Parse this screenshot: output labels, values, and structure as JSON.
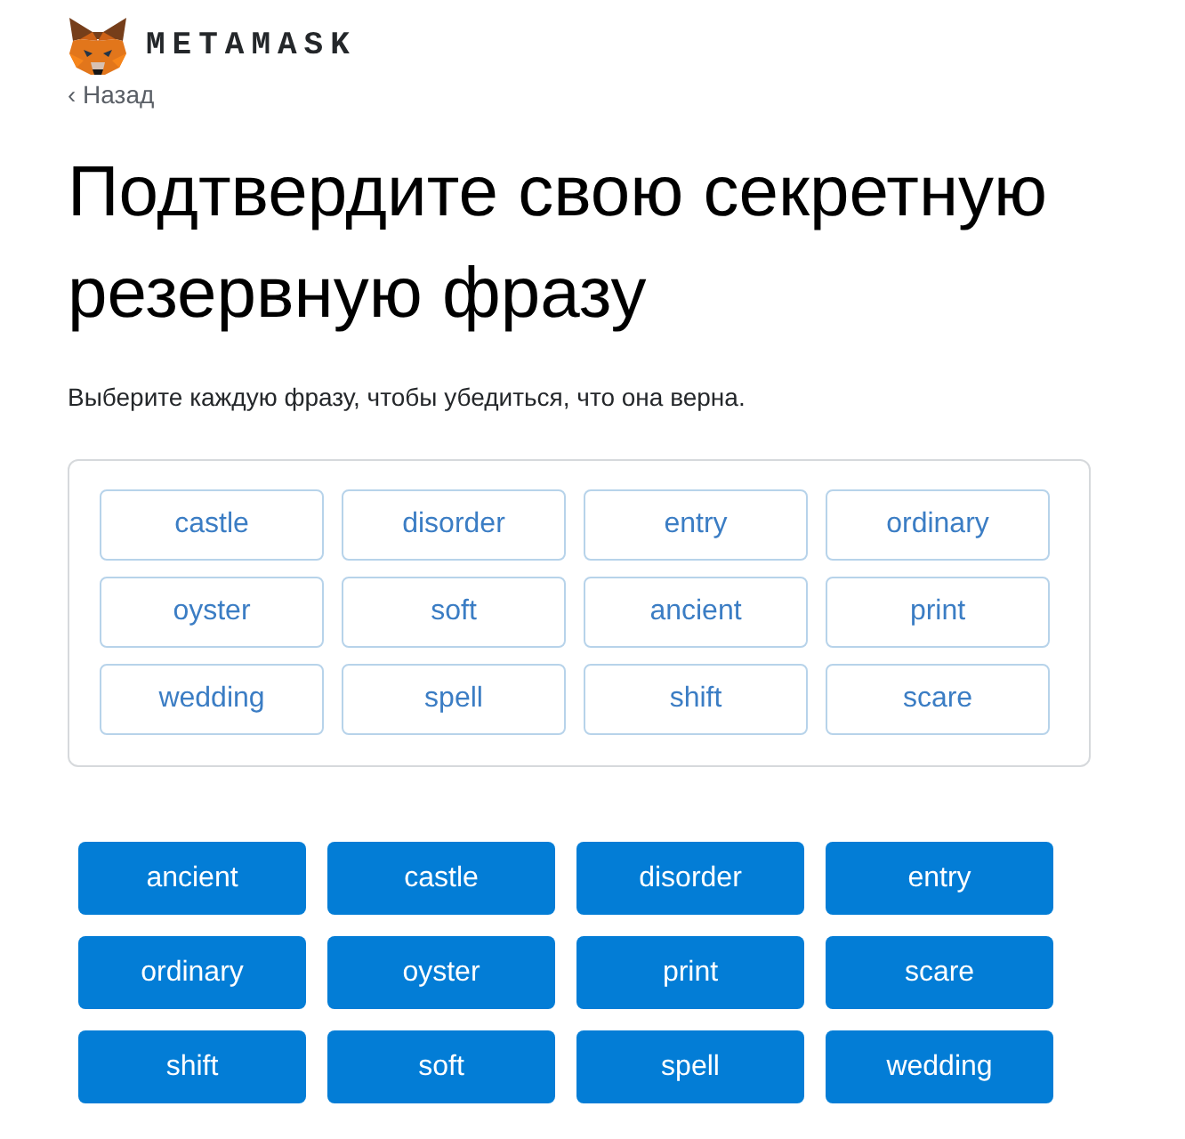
{
  "header": {
    "brand": "METAMASK"
  },
  "back_link": "‹ Назад",
  "title": "Подтвердите свою секретную резервную фразу",
  "instructions": "Выберите каждую фразу, чтобы убедиться, что она верна.",
  "selected_words": [
    "castle",
    "disorder",
    "entry",
    "ordinary",
    "oyster",
    "soft",
    "ancient",
    "print",
    "wedding",
    "spell",
    "shift",
    "scare"
  ],
  "word_buttons": [
    "ancient",
    "castle",
    "disorder",
    "entry",
    "ordinary",
    "oyster",
    "print",
    "scare",
    "shift",
    "soft",
    "spell",
    "wedding"
  ]
}
